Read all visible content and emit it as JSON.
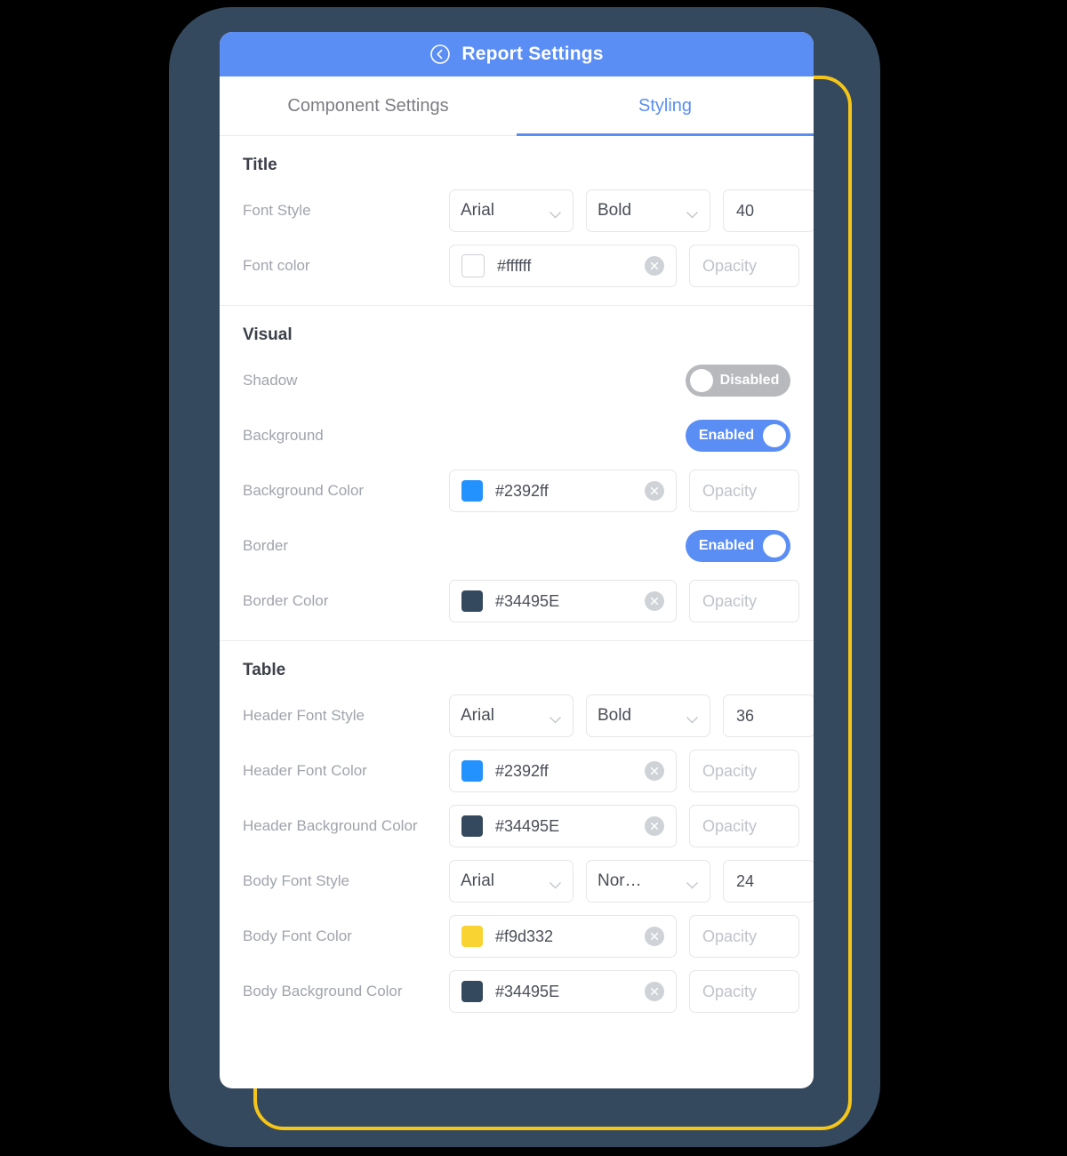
{
  "header": {
    "title": "Report Settings",
    "back_icon": "back-circle-icon",
    "bg_color": "#5b8ef5"
  },
  "tabs": [
    {
      "label": "Component Settings",
      "active": false
    },
    {
      "label": "Styling",
      "active": true
    }
  ],
  "sections": [
    {
      "title": "Title",
      "rows": [
        {
          "label": "Font Style",
          "type": "font",
          "family": "Arial",
          "weight": "Bold",
          "size": "40"
        },
        {
          "label": "Font color",
          "type": "color",
          "swatch": "#ffffff",
          "hex": "#ffffff",
          "opacity_placeholder": "Opacity",
          "clear_icon": "clear-circle-icon"
        }
      ]
    },
    {
      "title": "Visual",
      "rows": [
        {
          "label": "Shadow",
          "type": "toggle",
          "state": "Disabled",
          "on": false
        },
        {
          "label": "Background",
          "type": "toggle",
          "state": "Enabled",
          "on": true
        },
        {
          "label": "Background Color",
          "type": "color",
          "swatch": "#2392ff",
          "hex": "#2392ff",
          "opacity_placeholder": "Opacity",
          "clear_icon": "clear-circle-icon"
        },
        {
          "label": "Border",
          "type": "toggle",
          "state": "Enabled",
          "on": true
        },
        {
          "label": "Border Color",
          "type": "color",
          "swatch": "#34495E",
          "hex": "#34495E",
          "opacity_placeholder": "Opacity",
          "clear_icon": "clear-circle-icon"
        }
      ]
    },
    {
      "title": "Table",
      "rows": [
        {
          "label": "Header Font Style",
          "type": "font",
          "family": "Arial",
          "weight": "Bold",
          "size": "36"
        },
        {
          "label": "Header Font Color",
          "type": "color",
          "swatch": "#2392ff",
          "hex": "#2392ff",
          "opacity_placeholder": "Opacity",
          "clear_icon": "clear-circle-icon"
        },
        {
          "label": "Header Background Color",
          "type": "color",
          "swatch": "#34495E",
          "hex": "#34495E",
          "opacity_placeholder": "Opacity",
          "clear_icon": "clear-circle-icon"
        },
        {
          "label": "Body Font Style",
          "type": "font",
          "family": "Arial",
          "weight": "Nor…",
          "size": "24"
        },
        {
          "label": "Body Font Color",
          "type": "color",
          "swatch": "#f9d332",
          "hex": "#f9d332",
          "opacity_placeholder": "Opacity",
          "clear_icon": "clear-circle-icon"
        },
        {
          "label": "Body Background Color",
          "type": "color",
          "swatch": "#34495E",
          "hex": "#34495E",
          "opacity_placeholder": "Opacity",
          "clear_icon": "clear-circle-icon"
        }
      ]
    }
  ],
  "frame": {
    "bezel_color": "#34495e",
    "accent_color": "#f5c518"
  }
}
